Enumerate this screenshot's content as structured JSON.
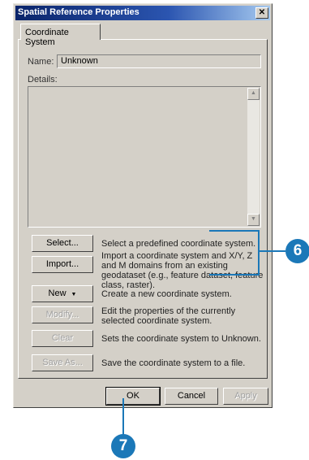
{
  "window": {
    "title": "Spatial Reference Properties",
    "close_glyph": "✕"
  },
  "tab": {
    "label": "Coordinate System"
  },
  "fields": {
    "name_label": "Name:",
    "name_value": "Unknown",
    "details_label": "Details:"
  },
  "actions": [
    {
      "label": "Select...",
      "description": "Select a predefined coordinate system.",
      "enabled": true,
      "dropdown": false
    },
    {
      "label": "Import...",
      "description": "Import a coordinate system and X/Y, Z and M domains from an existing geodataset (e.g., feature dataset, feature class, raster).",
      "enabled": true,
      "dropdown": false
    },
    {
      "label": "New",
      "description": "Create a new coordinate system.",
      "enabled": true,
      "dropdown": true
    },
    {
      "label": "Modify...",
      "description": "Edit the properties of the currently selected coordinate system.",
      "enabled": false,
      "dropdown": false
    },
    {
      "label": "Clear",
      "description": "Sets the coordinate system to Unknown.",
      "enabled": false,
      "dropdown": false
    },
    {
      "label": "Save As...",
      "description": "Save the coordinate system to a file.",
      "enabled": false,
      "dropdown": false
    }
  ],
  "footer": {
    "ok": "OK",
    "cancel": "Cancel",
    "apply": "Apply"
  },
  "callouts": {
    "step6": "6",
    "step7": "7",
    "color": "#1b78b8"
  }
}
